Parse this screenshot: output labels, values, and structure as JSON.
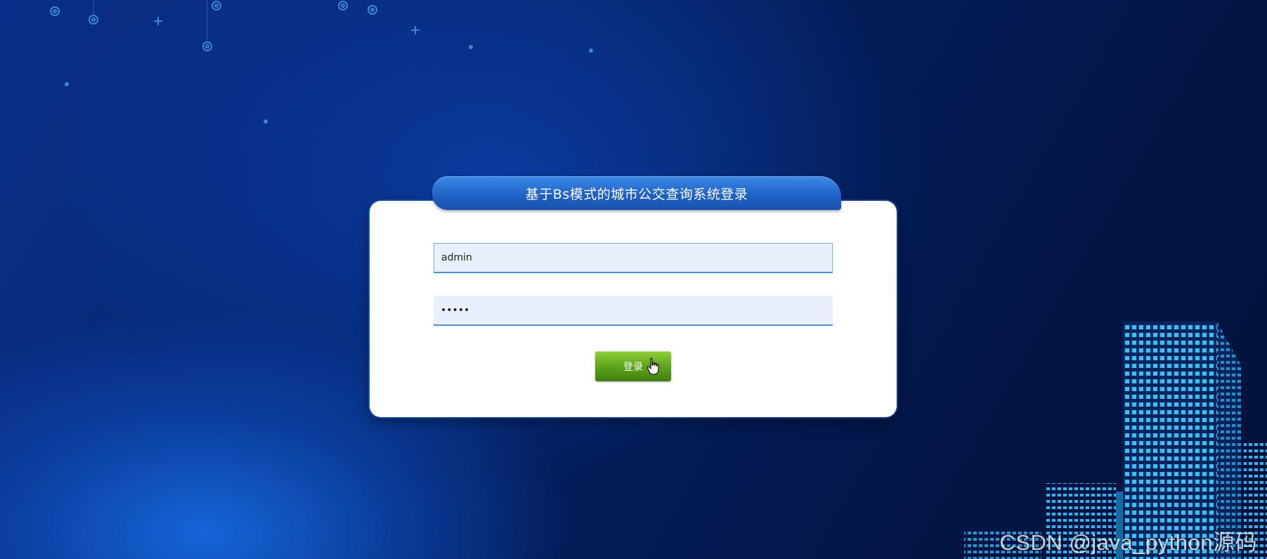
{
  "login": {
    "title": "基于Bs模式的城市公交查询系统登录",
    "username_value": "admin",
    "password_value": "•••••",
    "login_label": "登录"
  },
  "watermark": "CSDN @java_python源码",
  "colors": {
    "title_bar": "#1d5fc4",
    "input_bg": "#e8f0fe",
    "login_button": "#5ea51c",
    "buildings": "#29b6f6"
  },
  "icons": [
    "gear-icon",
    "plus-icon",
    "dot-icon",
    "pointer-hand-icon"
  ]
}
